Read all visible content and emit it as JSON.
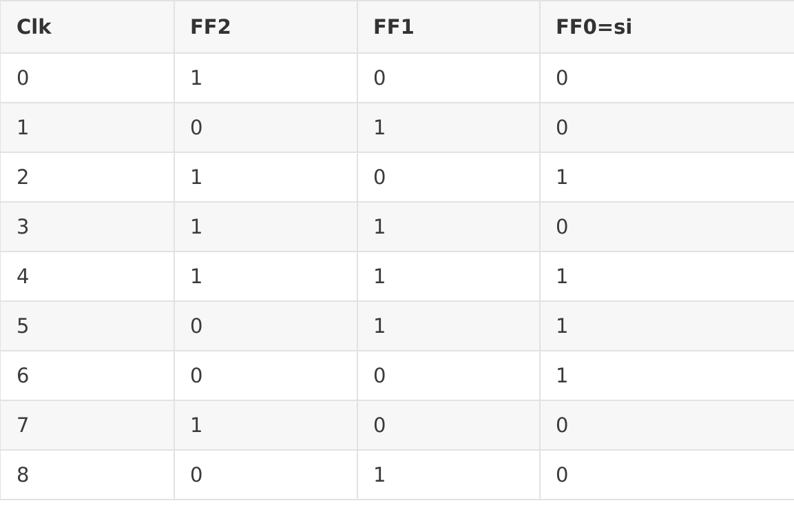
{
  "table": {
    "headers": [
      "Clk",
      "FF2",
      "FF1",
      "FF0=si"
    ],
    "rows": [
      [
        "0",
        "1",
        "0",
        "0"
      ],
      [
        "1",
        "0",
        "1",
        "0"
      ],
      [
        "2",
        "1",
        "0",
        "1"
      ],
      [
        "3",
        "1",
        "1",
        "0"
      ],
      [
        "4",
        "1",
        "1",
        "1"
      ],
      [
        "5",
        "0",
        "1",
        "1"
      ],
      [
        "6",
        "0",
        "0",
        "1"
      ],
      [
        "7",
        "1",
        "0",
        "0"
      ],
      [
        "8",
        "0",
        "1",
        "0"
      ]
    ]
  },
  "colors": {
    "border": "#e2e2e2",
    "header_bg": "#f7f7f7",
    "stripe_bg": "#f7f7f7",
    "text": "#333333"
  }
}
